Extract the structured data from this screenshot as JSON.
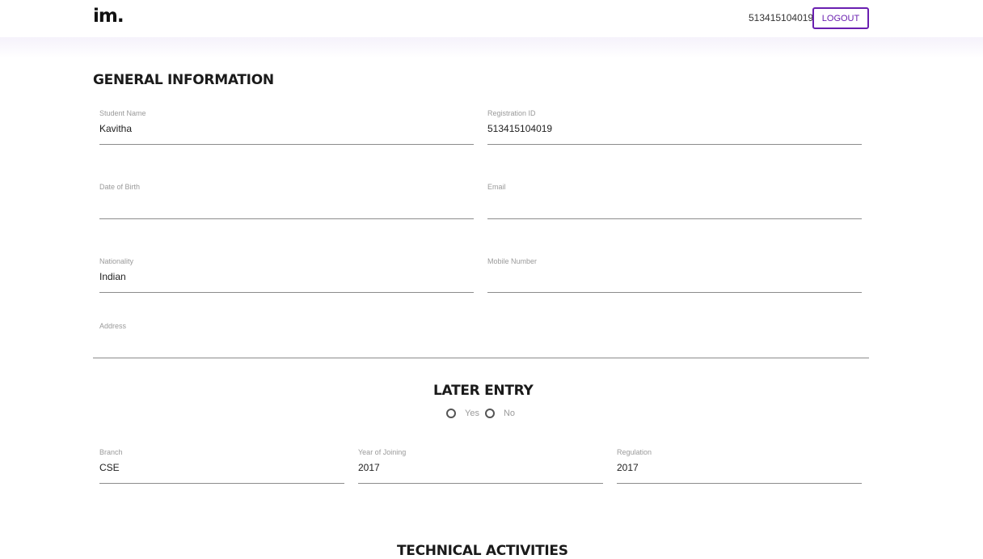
{
  "header": {
    "logo": "im.",
    "user_id": "513415104019",
    "logout_label": "LOGOUT"
  },
  "general": {
    "title": "GENERAL INFORMATION",
    "student_name": {
      "label": "Student Name",
      "value": "Kavitha"
    },
    "registration_id": {
      "label": "Registration ID",
      "value": "513415104019"
    },
    "date_of_birth": {
      "label": "Date of Birth",
      "value": ""
    },
    "email": {
      "label": "Email",
      "value": ""
    },
    "nationality": {
      "label": "Nationality",
      "value": "Indian"
    },
    "mobile_number": {
      "label": "Mobile Number",
      "value": ""
    },
    "address": {
      "label": "Address",
      "value": ""
    }
  },
  "later_entry": {
    "title": "LATER ENTRY",
    "options": [
      "Yes",
      "No"
    ]
  },
  "academic": {
    "branch": {
      "label": "Branch",
      "value": "CSE"
    },
    "year_of_joining": {
      "label": "Year of Joining",
      "value": "2017"
    },
    "regulation": {
      "label": "Regulation",
      "value": "2017"
    }
  },
  "technical": {
    "title": "TECHNICAL ACTIVITIES"
  }
}
